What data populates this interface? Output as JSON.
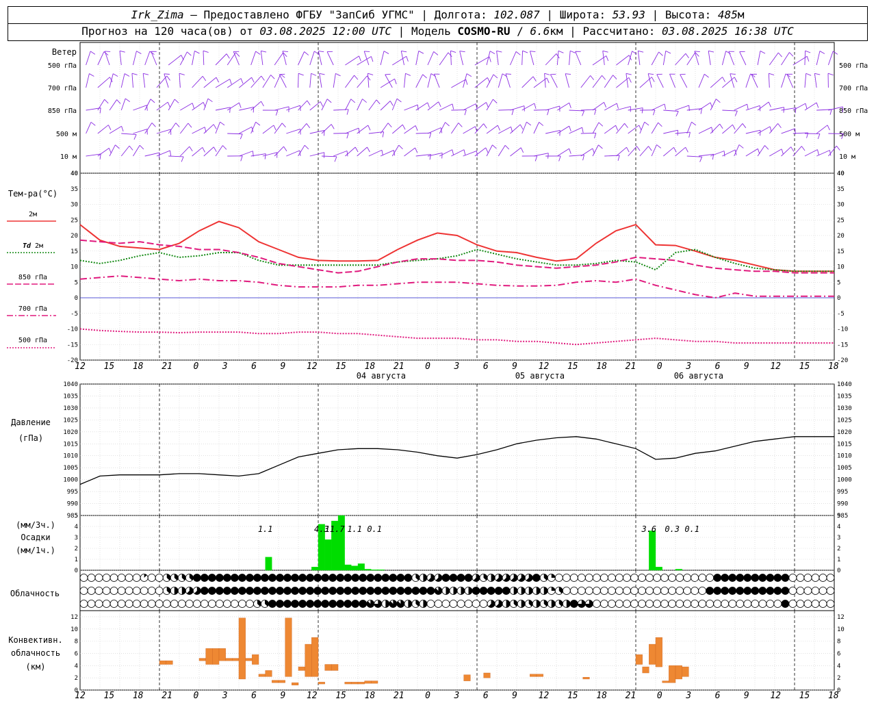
{
  "header": {
    "station": "Irk_Zima",
    "dash": " – ",
    "provided": "Предоставлено ФГБУ \"ЗапСиб УГМС\"",
    "lon_label": "Долгота:",
    "lon": "102.087",
    "lat_label": "Широта:",
    "lat": "53.93",
    "alt_label": "Высота:",
    "alt": "485",
    "alt_unit": "м",
    "forecast_label": "Прогноз на 120 часа(ов) от",
    "forecast_start": "03.08.2025 12:00 UTC",
    "model_label": "Модель",
    "model": "COSMO-RU",
    "resolution": "6.6",
    "resolution_unit": "км",
    "computed_label": "Рассчитано:",
    "computed": "03.08.2025 16:38 UTC"
  },
  "chart_data": [
    {
      "id": "wind",
      "type": "other",
      "title": "Ветер",
      "levels": [
        "500 гПа",
        "700 гПа",
        "850 гПа",
        "500 м",
        "10 м"
      ],
      "color": "#8a2be2"
    },
    {
      "id": "temperature",
      "type": "line",
      "title": "Тем-ра(°С)",
      "ylim": [
        -20,
        40
      ],
      "yticks": [
        -20,
        -15,
        -10,
        -5,
        0,
        5,
        10,
        15,
        20,
        25,
        30,
        35,
        40
      ],
      "x_hours": [
        0,
        3,
        6,
        9,
        12,
        15,
        18,
        21,
        24,
        27,
        30,
        33,
        36,
        39,
        42,
        45,
        48,
        51,
        54,
        57,
        60,
        63,
        66,
        69,
        72,
        75,
        78,
        81,
        84,
        87,
        90,
        93,
        96,
        99,
        102,
        105,
        108,
        111,
        114
      ],
      "series": [
        {
          "name": "2м",
          "color": "#ee3333",
          "dash": "solid",
          "values": [
            23.5,
            18.5,
            16.5,
            16.0,
            15.5,
            17.5,
            21.5,
            24.5,
            22.5,
            18.0,
            15.5,
            13.0,
            12.0,
            11.8,
            11.8,
            12.0,
            15.5,
            18.5,
            20.8,
            20.0,
            17.0,
            15.0,
            14.5,
            13.0,
            11.8,
            12.5,
            17.5,
            21.5,
            23.5,
            17.0,
            16.8,
            15.0,
            13.0,
            12.0,
            10.5,
            9.0,
            8.5,
            8.5,
            8.5
          ]
        },
        {
          "name": "Td 2м",
          "color": "#118811",
          "dash": "dot",
          "values": [
            12.0,
            11.0,
            12.0,
            13.5,
            14.5,
            13.0,
            13.5,
            14.5,
            14.5,
            12.0,
            10.5,
            10.5,
            10.5,
            10.5,
            10.5,
            10.5,
            11.5,
            12.0,
            12.5,
            13.5,
            15.5,
            14.0,
            12.5,
            11.5,
            10.5,
            10.5,
            11.0,
            12.0,
            11.5,
            9.0,
            14.5,
            15.5,
            13.0,
            11.0,
            9.5,
            9.0,
            8.5,
            8.5,
            8.5
          ]
        },
        {
          "name": "850 гПа",
          "color": "#e0197d",
          "dash": "longdash",
          "values": [
            18.5,
            18.0,
            17.5,
            18.0,
            17.0,
            16.5,
            15.5,
            15.5,
            14.5,
            13.0,
            11.0,
            10.0,
            9.0,
            8.0,
            8.5,
            10.0,
            11.5,
            12.5,
            12.5,
            12.0,
            12.0,
            11.5,
            10.5,
            10.0,
            9.5,
            10.0,
            10.5,
            11.5,
            13.0,
            12.5,
            12.0,
            10.5,
            9.5,
            9.0,
            8.5,
            8.5,
            8.0,
            8.0,
            8.0
          ]
        },
        {
          "name": "700 гПа",
          "color": "#e0197d",
          "dash": "dashdot",
          "values": [
            6.0,
            6.5,
            7.0,
            6.5,
            6.0,
            5.5,
            6.0,
            5.5,
            5.5,
            5.0,
            4.0,
            3.5,
            3.5,
            3.5,
            4.0,
            4.0,
            4.5,
            5.0,
            5.0,
            5.0,
            4.5,
            4.0,
            3.8,
            3.8,
            4.0,
            5.0,
            5.5,
            5.0,
            6.0,
            4.0,
            2.5,
            1.0,
            0.0,
            1.5,
            0.5,
            0.5,
            0.5,
            0.5,
            0.5
          ]
        },
        {
          "name": "500 гПа",
          "color": "#e0197d",
          "dash": "dot",
          "values": [
            -10.0,
            -10.5,
            -10.8,
            -11.0,
            -11.0,
            -11.2,
            -11.0,
            -11.0,
            -11.0,
            -11.5,
            -11.5,
            -11.0,
            -11.0,
            -11.5,
            -11.5,
            -12.0,
            -12.5,
            -13.0,
            -13.0,
            -13.0,
            -13.5,
            -13.5,
            -14.0,
            -14.0,
            -14.5,
            -15.0,
            -14.5,
            -14.0,
            -13.5,
            -13.0,
            -13.5,
            -14.0,
            -14.0,
            -14.5,
            -14.5,
            -14.5,
            -14.5,
            -14.5,
            -14.5
          ]
        }
      ]
    },
    {
      "id": "pressure",
      "type": "line",
      "title": "Давление",
      "ylabel": "(гПа)",
      "ylim": [
        985,
        1040
      ],
      "yticks": [
        985,
        990,
        995,
        1000,
        1005,
        1010,
        1015,
        1020,
        1025,
        1030,
        1035,
        1040
      ],
      "x_hours": [
        0,
        3,
        6,
        9,
        12,
        15,
        18,
        21,
        24,
        27,
        30,
        33,
        36,
        39,
        42,
        45,
        48,
        51,
        54,
        57,
        60,
        63,
        66,
        69,
        72,
        75,
        78,
        81,
        84,
        87,
        90,
        93,
        96,
        99,
        102,
        105,
        108,
        111,
        114
      ],
      "series": [
        {
          "name": "",
          "color": "#000000",
          "dash": "solid",
          "values": [
            998.0,
            1001.5,
            1002.0,
            1002.0,
            1002.0,
            1002.5,
            1002.5,
            1002.0,
            1001.5,
            1002.5,
            1006.0,
            1009.5,
            1011.0,
            1012.5,
            1013.0,
            1013.0,
            1012.5,
            1011.5,
            1010.0,
            1009.0,
            1010.5,
            1012.5,
            1015.0,
            1016.5,
            1017.5,
            1018.0,
            1017.0,
            1015.0,
            1013.0,
            1008.5,
            1009.0,
            1011.0,
            1012.0,
            1014.0,
            1016.0,
            1017.0,
            1018.0,
            1018.0,
            1018.0
          ]
        }
      ]
    },
    {
      "id": "precipitation",
      "type": "bar",
      "title": "Осадки",
      "ylabel_top": "(мм/3ч.)",
      "ylabel_bottom": "(мм/1ч.)",
      "ylim": [
        0,
        5
      ],
      "yticks": [
        0,
        1,
        2,
        3,
        4,
        5
      ],
      "color": "#00dd00",
      "hours": [
        28.5,
        35.5,
        36.5,
        37.5,
        38.5,
        39.5,
        40.5,
        41.5,
        42.5,
        43.5,
        44.5,
        45.5,
        86.5,
        87.5,
        90.5
      ],
      "values": [
        1.2,
        0.3,
        4.2,
        2.8,
        4.5,
        5.0,
        0.5,
        0.4,
        0.6,
        0.1,
        0.05,
        0.05,
        3.6,
        0.3,
        0.1
      ],
      "labels": [
        {
          "hour": 28.0,
          "text": "1.1"
        },
        {
          "hour": 36.5,
          "text": "4.3"
        },
        {
          "hour": 38.5,
          "text": "11.7"
        },
        {
          "hour": 41.5,
          "text": "1.1"
        },
        {
          "hour": 44.5,
          "text": "0.1"
        },
        {
          "hour": 86.0,
          "text": "3.6"
        },
        {
          "hour": 89.5,
          "text": "0.3"
        },
        {
          "hour": 92.5,
          "text": "0.1"
        }
      ]
    },
    {
      "id": "cloudiness",
      "type": "other",
      "title": "Облачность",
      "rows": [
        "0000000000010002334333888888888888888888888888888888888888888888834555888888553445555555883220000000000000000000000000000008888888888888888000000000",
        "00000000000000023445554888888888888888888888888888888888888888888888744444488888888442444423600000000000000000000000000008888888888888880000000000",
        "00000000000000000000000000000000003388888888888888888888776477744344000000000000555433434434434488666000000000000000000000000000000000000088000000000"
      ]
    },
    {
      "id": "convective",
      "type": "bar",
      "title": "Конвективн.",
      "title2": "облачность",
      "ylabel": "(км)",
      "ylim": [
        0,
        13
      ],
      "yticks": [
        0,
        2,
        4,
        6,
        8,
        10,
        12
      ],
      "color": "#ee8833",
      "bars": [
        {
          "h": 12.5,
          "b": 4.2,
          "t": 4.8
        },
        {
          "h": 13.5,
          "b": 4.2,
          "t": 4.8
        },
        {
          "h": 18.5,
          "b": 4.8,
          "t": 5.2
        },
        {
          "h": 19.5,
          "b": 4.2,
          "t": 6.8
        },
        {
          "h": 20.5,
          "b": 4.2,
          "t": 6.8
        },
        {
          "h": 21.5,
          "b": 4.8,
          "t": 6.8
        },
        {
          "h": 22.5,
          "b": 4.8,
          "t": 5.2
        },
        {
          "h": 23.5,
          "b": 4.8,
          "t": 5.2
        },
        {
          "h": 24.5,
          "b": 1.8,
          "t": 11.8
        },
        {
          "h": 25.5,
          "b": 4.8,
          "t": 5.2
        },
        {
          "h": 26.5,
          "b": 4.2,
          "t": 5.8
        },
        {
          "h": 27.5,
          "b": 2.2,
          "t": 2.6
        },
        {
          "h": 28.5,
          "b": 2.2,
          "t": 3.2
        },
        {
          "h": 29.5,
          "b": 1.2,
          "t": 1.6
        },
        {
          "h": 30.5,
          "b": 1.2,
          "t": 1.6
        },
        {
          "h": 31.5,
          "b": 2.2,
          "t": 11.8
        },
        {
          "h": 32.5,
          "b": 0.8,
          "t": 1.2
        },
        {
          "h": 33.5,
          "b": 3.2,
          "t": 3.8
        },
        {
          "h": 34.5,
          "b": 2.2,
          "t": 7.5
        },
        {
          "h": 35.5,
          "b": 2.2,
          "t": 8.6
        },
        {
          "h": 36.5,
          "b": 1.0,
          "t": 1.3
        },
        {
          "h": 37.5,
          "b": 3.2,
          "t": 4.2
        },
        {
          "h": 38.5,
          "b": 3.2,
          "t": 4.2
        },
        {
          "h": 40.5,
          "b": 1.0,
          "t": 1.3
        },
        {
          "h": 41.5,
          "b": 1.0,
          "t": 1.3
        },
        {
          "h": 42.5,
          "b": 1.0,
          "t": 1.3
        },
        {
          "h": 43.5,
          "b": 1.1,
          "t": 1.5
        },
        {
          "h": 44.5,
          "b": 1.1,
          "t": 1.5
        },
        {
          "h": 58.5,
          "b": 1.5,
          "t": 2.5
        },
        {
          "h": 61.5,
          "b": 2.0,
          "t": 2.8
        },
        {
          "h": 68.5,
          "b": 2.2,
          "t": 2.6
        },
        {
          "h": 69.5,
          "b": 2.2,
          "t": 2.6
        },
        {
          "h": 76.5,
          "b": 1.8,
          "t": 2.1
        },
        {
          "h": 84.5,
          "b": 4.2,
          "t": 5.8
        },
        {
          "h": 85.5,
          "b": 2.8,
          "t": 3.8
        },
        {
          "h": 86.5,
          "b": 4.2,
          "t": 7.5
        },
        {
          "h": 87.5,
          "b": 3.8,
          "t": 8.6
        },
        {
          "h": 88.5,
          "b": 1.2,
          "t": 1.5
        },
        {
          "h": 89.5,
          "b": 1.2,
          "t": 4.0
        },
        {
          "h": 90.5,
          "b": 1.8,
          "t": 4.0
        },
        {
          "h": 91.5,
          "b": 2.2,
          "t": 3.8
        }
      ]
    }
  ],
  "legend": {
    "t2m": "2м",
    "td_sym": "Td",
    "td_lvl": "2м",
    "p850": "850 гПа",
    "p700": "700 гПа",
    "p500": "500 гПа"
  },
  "axis": {
    "hour_labels": [
      "12",
      "15",
      "18",
      "21",
      "0",
      "3",
      "6",
      "9",
      "12",
      "15",
      "18",
      "21",
      "0",
      "3",
      "6",
      "9",
      "12",
      "15",
      "18",
      "21",
      "0",
      "3",
      "6",
      "9",
      "12",
      "15",
      "18"
    ],
    "day_labels": [
      {
        "hour": 45.5,
        "text": "04 августа"
      },
      {
        "hour": 69.5,
        "text": "05 августа"
      },
      {
        "hour": 93.5,
        "text": "06 августа"
      }
    ]
  }
}
